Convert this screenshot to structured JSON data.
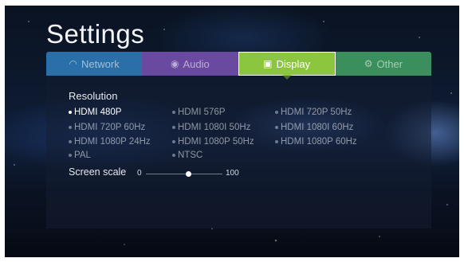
{
  "title": "Settings",
  "tabs": [
    {
      "label": "Network",
      "icon": "wifi-icon",
      "color": "#2a6fa8"
    },
    {
      "label": "Audio",
      "icon": "speaker-icon",
      "color": "#6a49a0"
    },
    {
      "label": "Display",
      "icon": "play-square-icon",
      "color": "#8cc63e",
      "active": true
    },
    {
      "label": "Other",
      "icon": "gear-icon",
      "color": "#3a8f5c"
    }
  ],
  "resolution": {
    "label": "Resolution",
    "options": [
      "HDMI 480P",
      "HDMI 576P",
      "HDMI 720P 50Hz",
      "HDMI 720P 60Hz",
      "HDMI 1080I 50Hz",
      "HDMI 1080I 60Hz",
      "HDMI 1080P 24Hz",
      "HDMI 1080P 50Hz",
      "HDMI 1080P 60Hz",
      "PAL",
      "NTSC"
    ],
    "selected": "HDMI 480P"
  },
  "screen_scale": {
    "label": "Screen scale",
    "min": "0",
    "max": "100",
    "value": 55
  }
}
